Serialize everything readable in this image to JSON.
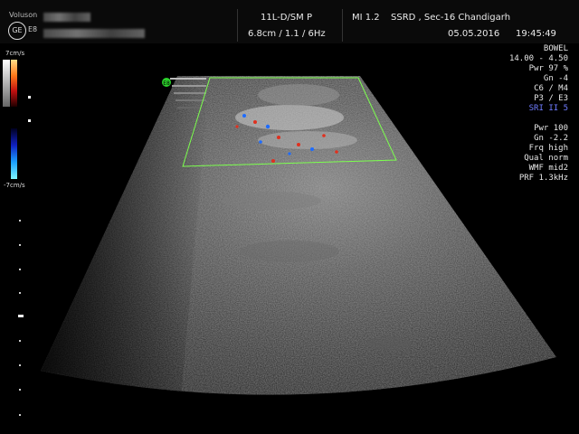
{
  "header": {
    "brand": "Voluson",
    "logo": "GE",
    "model": "E8",
    "probe": "11L-D/SM P",
    "mi": "MI  1.2",
    "institution": "SSRD , Sec-16 Chandigarh",
    "depth_freq": "6.8cm / 1.1 /  6Hz",
    "date": "05.05.2016",
    "time": "19:45:49"
  },
  "params_bmode": {
    "preset": "BOWEL",
    "range": "14.00 - 4.50",
    "pwr": "Pwr  97 %",
    "gn": "Gn  -4",
    "c_m": "C6 / M4",
    "p_e": "P3 / E3",
    "sri": "SRI II 5"
  },
  "params_color": {
    "pwr": "Pwr 100",
    "gn": "Gn -2.2",
    "frq": "Frq high",
    "qual": "Qual norm",
    "wmf": "WMF mid2",
    "prf": "PRF  1.3kHz"
  },
  "colorbar": {
    "top_label": "7cm/s",
    "bottom_label": "-7cm/s"
  },
  "colors": {
    "sri": "#6f7cff",
    "roi": "#7cff4e"
  }
}
